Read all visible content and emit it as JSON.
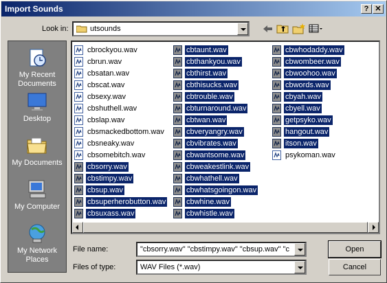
{
  "window": {
    "title": "Import Sounds",
    "help_label": "?",
    "close_label": "✕"
  },
  "lookin": {
    "label": "Look in:",
    "value": "utsounds"
  },
  "toolbar": [
    {
      "name": "back-icon"
    },
    {
      "name": "up-folder-icon"
    },
    {
      "name": "new-folder-icon"
    },
    {
      "name": "view-menu-icon"
    }
  ],
  "places": [
    {
      "label": "My Recent Documents",
      "icon": "recent-documents-icon"
    },
    {
      "label": "Desktop",
      "icon": "desktop-icon"
    },
    {
      "label": "My Documents",
      "icon": "my-documents-icon"
    },
    {
      "label": "My Computer",
      "icon": "my-computer-icon"
    },
    {
      "label": "My Network Places",
      "icon": "network-places-icon"
    }
  ],
  "files": {
    "columns": [
      [
        {
          "name": "cbrockyou.wav",
          "selected": false
        },
        {
          "name": "cbrun.wav",
          "selected": false
        },
        {
          "name": "cbsatan.wav",
          "selected": false
        },
        {
          "name": "cbscat.wav",
          "selected": false
        },
        {
          "name": "cbsexy.wav",
          "selected": false
        },
        {
          "name": "cbshuthell.wav",
          "selected": false
        },
        {
          "name": "cbslap.wav",
          "selected": false
        },
        {
          "name": "cbsmackedbottom.wav",
          "selected": false
        },
        {
          "name": "cbsneaky.wav",
          "selected": false
        },
        {
          "name": "cbsomebitch.wav",
          "selected": false
        },
        {
          "name": "cbsorry.wav",
          "selected": true
        },
        {
          "name": "cbstimpy.wav",
          "selected": true
        },
        {
          "name": "cbsup.wav",
          "selected": true
        },
        {
          "name": "cbsuperherobutton.wav",
          "selected": true
        },
        {
          "name": "cbsuxass.wav",
          "selected": true
        }
      ],
      [
        {
          "name": "cbtaunt.wav",
          "selected": true
        },
        {
          "name": "cbthankyou.wav",
          "selected": true
        },
        {
          "name": "cbthirst.wav",
          "selected": true
        },
        {
          "name": "cbthisucks.wav",
          "selected": true
        },
        {
          "name": "cbtrouble.wav",
          "selected": true
        },
        {
          "name": "cbturnaround.wav",
          "selected": true
        },
        {
          "name": "cbtwan.wav",
          "selected": true
        },
        {
          "name": "cbveryangry.wav",
          "selected": true
        },
        {
          "name": "cbvibrates.wav",
          "selected": true
        },
        {
          "name": "cbwantsome.wav",
          "selected": true
        },
        {
          "name": "cbweakestlink.wav",
          "selected": true
        },
        {
          "name": "cbwhathell.wav",
          "selected": true
        },
        {
          "name": "cbwhatsgoingon.wav",
          "selected": true
        },
        {
          "name": "cbwhine.wav",
          "selected": true
        },
        {
          "name": "cbwhistle.wav",
          "selected": true
        }
      ],
      [
        {
          "name": "cbwhodaddy.wav",
          "selected": true
        },
        {
          "name": "cbwombeer.wav",
          "selected": true
        },
        {
          "name": "cbwoohoo.wav",
          "selected": true
        },
        {
          "name": "cbwords.wav",
          "selected": true
        },
        {
          "name": "cbyah.wav",
          "selected": true
        },
        {
          "name": "cbyell.wav",
          "selected": true
        },
        {
          "name": "getpsyko.wav",
          "selected": true
        },
        {
          "name": "hangout.wav",
          "selected": true
        },
        {
          "name": "itson.wav",
          "selected": true
        },
        {
          "name": "psykoman.wav",
          "selected": false
        }
      ]
    ]
  },
  "filename": {
    "label": "File name:",
    "value": "\"cbsorry.wav\" \"cbstimpy.wav\" \"cbsup.wav\" \"c"
  },
  "filetype": {
    "label": "Files of type:",
    "value": "WAV Files (*.wav)"
  },
  "buttons": {
    "open": "Open",
    "cancel": "Cancel"
  },
  "colors": {
    "selection": "#0a246a",
    "title_start": "#0a246a",
    "title_end": "#a6caf0",
    "face": "#d4d0c8"
  }
}
